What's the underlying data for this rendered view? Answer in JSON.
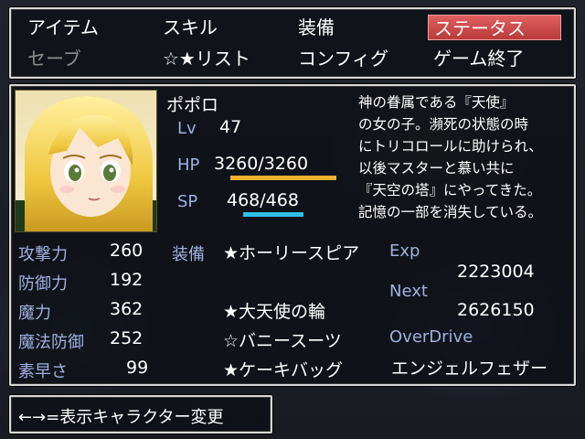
{
  "menu": {
    "items": [
      {
        "label": "アイテム",
        "state": "normal"
      },
      {
        "label": "スキル",
        "state": "normal"
      },
      {
        "label": "装備",
        "state": "normal"
      },
      {
        "label": "ステータス",
        "state": "selected"
      },
      {
        "label": "セーブ",
        "state": "disabled"
      },
      {
        "label": "☆★リスト",
        "state": "normal"
      },
      {
        "label": "コンフィグ",
        "state": "normal"
      },
      {
        "label": "ゲーム終了",
        "state": "normal"
      }
    ]
  },
  "character": {
    "name": "ポポロ",
    "level_label": "Lv",
    "level": "47",
    "hp_label": "HP",
    "hp": "3260/3260",
    "hp_fraction": 1.0,
    "sp_label": "SP",
    "sp": "468/468",
    "sp_fraction": 1.0,
    "bio": [
      "神の眷属である『天使』",
      "の女の子。瀕死の状態の時",
      "にトリコロールに助けられ、",
      "以後マスターと慕い共に",
      "『天空の塔』にやってきた。",
      "記憶の一部を消失している。"
    ]
  },
  "stats": [
    {
      "label": "攻撃力",
      "value": "260"
    },
    {
      "label": "防御力",
      "value": "192"
    },
    {
      "label": "魔力",
      "value": "362"
    },
    {
      "label": "魔法防御",
      "value": "252"
    },
    {
      "label": "素早さ",
      "value": "99"
    }
  ],
  "equipment": {
    "label": "装備",
    "items": [
      "★ホーリースピア",
      "",
      "★大天使の輪",
      "☆バニースーツ",
      "★ケーキバッグ"
    ]
  },
  "exp": {
    "exp_label": "Exp",
    "exp_value": "2223004",
    "next_label": "Next",
    "next_value": "2626150",
    "overdrive_label": "OverDrive",
    "overdrive_value": "エンジェルフェザー"
  },
  "help": {
    "text": "←→=表示キャラクター変更"
  },
  "colors": {
    "selected_menu": "#c84848",
    "label_blue": "#9fb0e0",
    "hp_bar": "#f0b030",
    "sp_bar": "#30c0e8"
  }
}
